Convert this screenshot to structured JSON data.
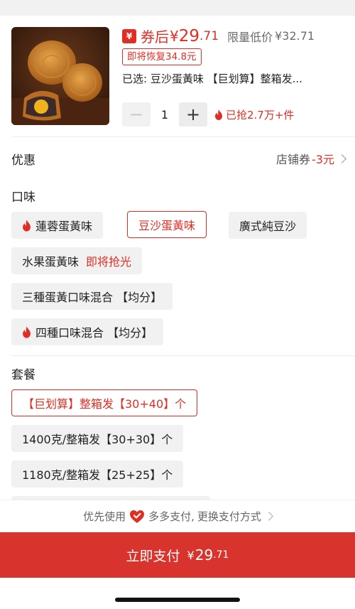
{
  "header": {
    "coupon_icon": "¥",
    "price_prefix": "券后",
    "price_symbol": "¥",
    "price_int": "29",
    "price_dec": ".71",
    "limit_label": "限量低价",
    "limit_value": "¥32.71",
    "restore_tag": "即将恢复34.8元",
    "selected_text": "已选: 豆沙蛋黃味 【巨划算】整箱发...",
    "quantity": "1",
    "minus_label": "−",
    "plus_label": "+",
    "grabbed_text": "已抢2.7万+件"
  },
  "discount": {
    "title": "优惠",
    "shop_coupon_label": "店铺券",
    "shop_coupon_value": "-3元"
  },
  "flavor": {
    "title": "口味",
    "options": [
      {
        "label": "蓮蓉蛋黃味",
        "hot": true
      },
      {
        "label": "豆沙蛋黃味",
        "selected": true
      },
      {
        "label": "廣式純豆沙"
      },
      {
        "label": "水果蛋黃味",
        "note": "即将抢光"
      },
      {
        "label": "三種蛋黃口味混合 【均分】"
      },
      {
        "label": "四種口味混合 【均分】",
        "hot": true
      }
    ]
  },
  "package": {
    "title": "套餐",
    "options": [
      {
        "label": "【巨划算】整箱发【30+40】个",
        "selected": true
      },
      {
        "label": "1400克/整箱发【30+30】个"
      },
      {
        "label": "1180克/整箱发【25+25】个"
      }
    ]
  },
  "payment": {
    "prefix": "优先使用",
    "method": "多多支付,",
    "change": "更换支付方式"
  },
  "pay_button": {
    "label": "立即支付",
    "symbol": "¥",
    "int": "29",
    "dec": ".71"
  },
  "colors": {
    "accent": "#e02e24",
    "pay_button": "#d8332c"
  }
}
